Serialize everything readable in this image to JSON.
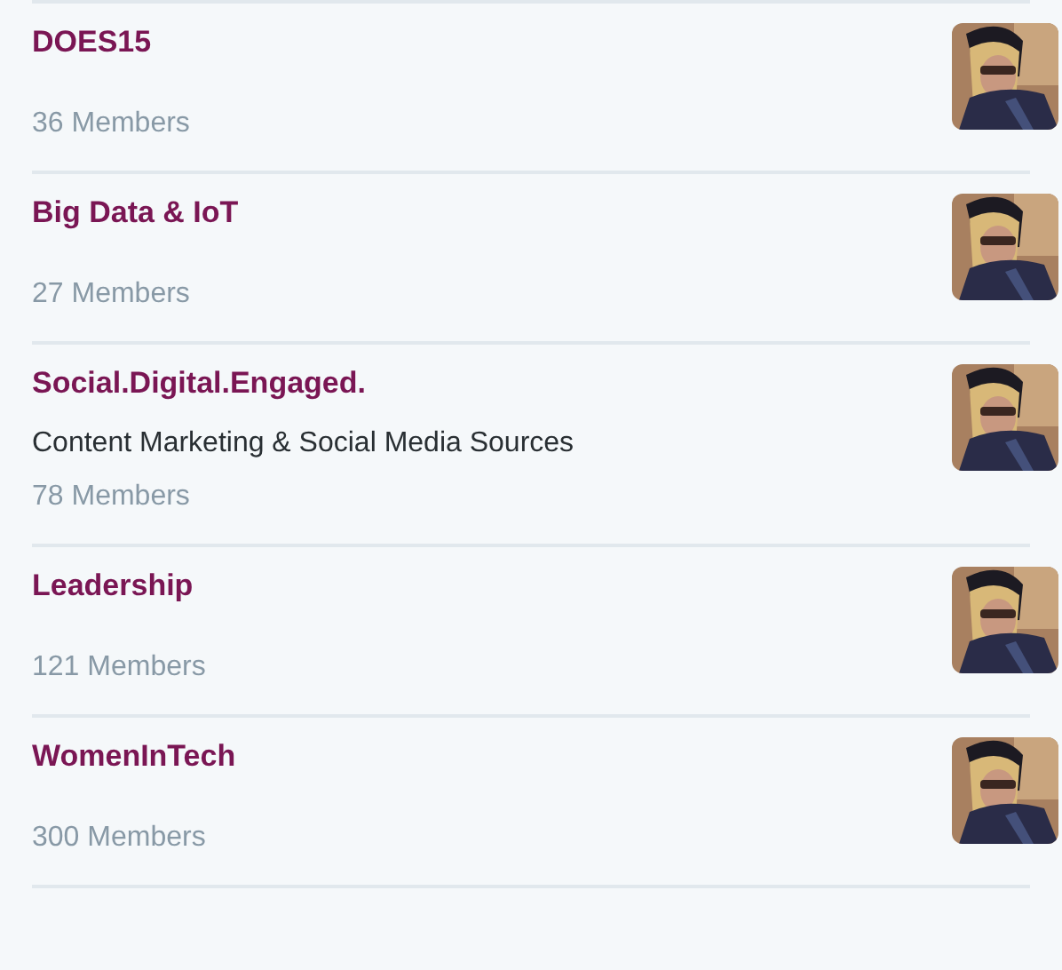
{
  "lists": [
    {
      "name": "DOES15",
      "members": "36 Members"
    },
    {
      "name": "Big Data & IoT",
      "members": "27 Members"
    },
    {
      "name": "Social.Digital.Engaged.",
      "description": "Content Marketing & Social Media Sources",
      "members": "78 Members"
    },
    {
      "name": "Leadership",
      "members": "121 Members"
    },
    {
      "name": "WomenInTech",
      "members": "300 Members"
    }
  ]
}
